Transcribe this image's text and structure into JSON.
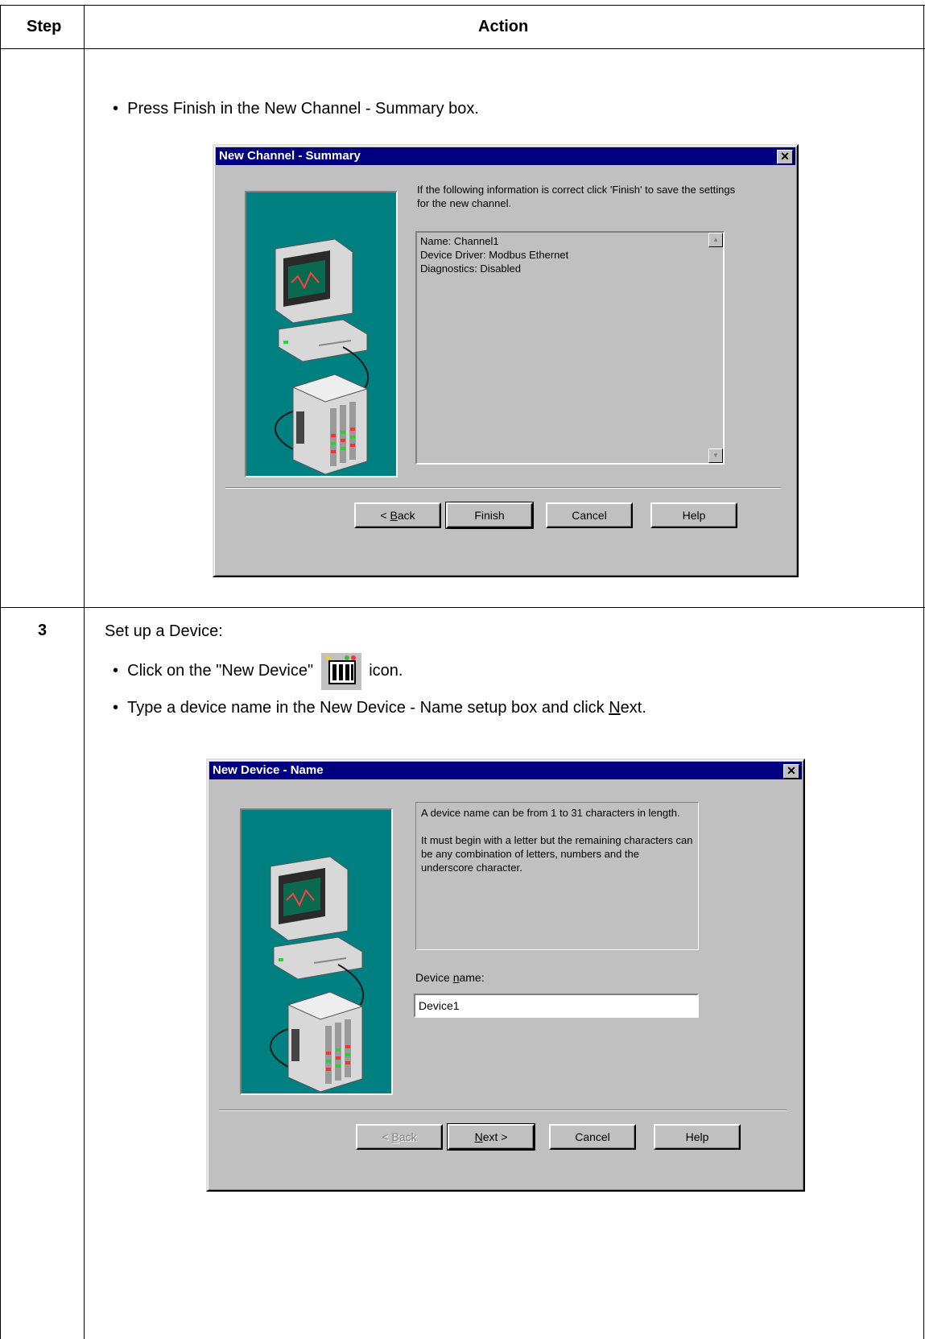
{
  "table": {
    "col_step": "Step",
    "col_action": "Action"
  },
  "row1": {
    "step": "",
    "bullet1": "Press Finish in the New Channel - Summary box."
  },
  "dialog1": {
    "title": "New Channel - Summary",
    "close": "✕",
    "info": "If the following information is correct click 'Finish' to save the settings for the new channel.",
    "list_lines": [
      "Name: Channel1",
      "Device Driver: Modbus Ethernet",
      "Diagnostics: Disabled"
    ],
    "buttons": {
      "back_pre": "< ",
      "back_u": "B",
      "back_post": "ack",
      "finish": "Finish",
      "cancel": "Cancel",
      "help": "Help"
    }
  },
  "row2": {
    "step": "3",
    "intro": "Set up a Device:",
    "bullet1_pre": "Click on the \"New Device\"",
    "bullet1_post": "icon.",
    "bullet2_pre": "Type a device name in the New Device - Name setup box and click ",
    "bullet2_u": "N",
    "bullet2_post": "ext."
  },
  "dialog2": {
    "title": "New Device - Name",
    "close": "✕",
    "info_p1": "A device name can be from 1 to 31 characters in length.",
    "info_p2": "It must begin with a letter but the remaining characters can be any combination of letters, numbers and the underscore character.",
    "field_label_pre": "Device ",
    "field_label_u": "n",
    "field_label_post": "ame:",
    "field_value": "Device1",
    "buttons": {
      "back_pre": "< ",
      "back_u": "B",
      "back_post": "ack",
      "next_u": "N",
      "next_post": "ext >",
      "cancel": "Cancel",
      "help": "Help"
    }
  },
  "colors": {
    "title_bar": "#000080",
    "dialog_face": "#c0c0c0",
    "illustration_panel": "#008080"
  },
  "icons": [
    "close-icon",
    "computer-icon",
    "device-rack-icon",
    "new-device-icon",
    "scroll-up-icon",
    "scroll-down-icon"
  ]
}
